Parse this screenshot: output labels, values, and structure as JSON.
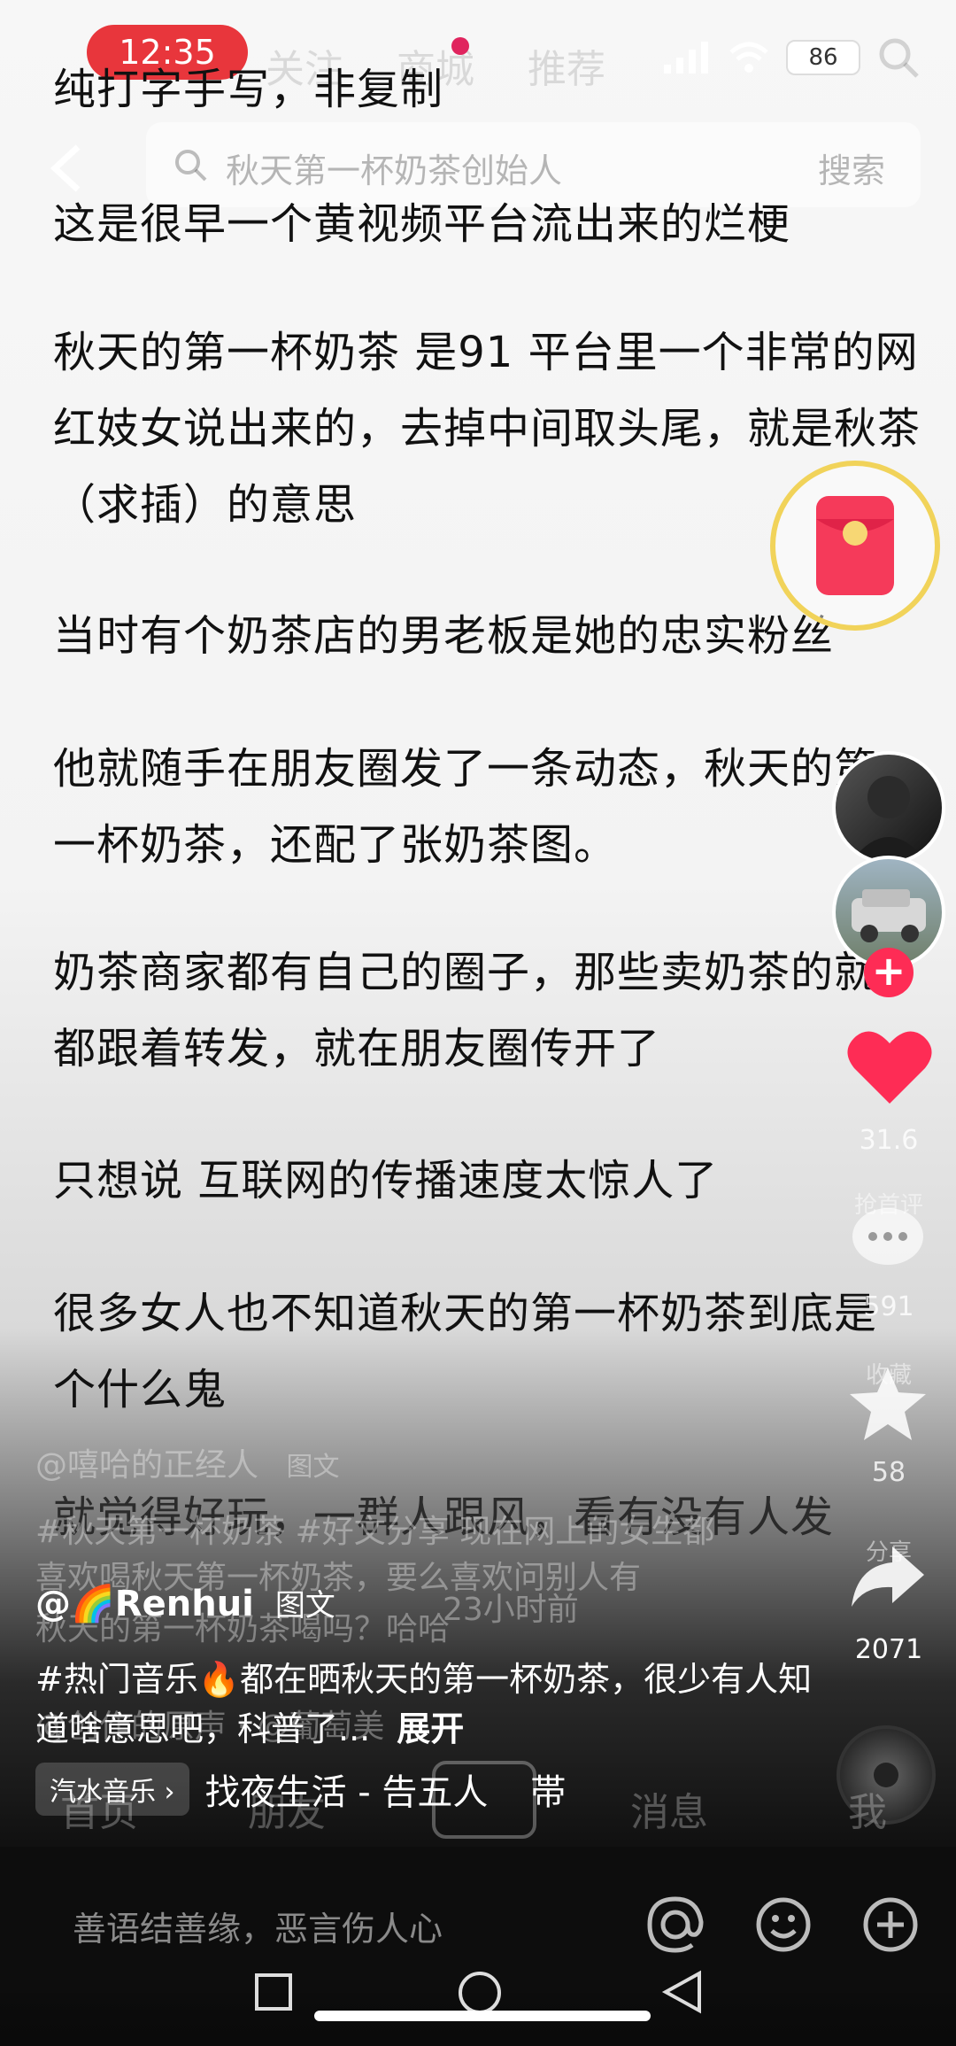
{
  "status_bar": {
    "time": "12:35",
    "battery": "86"
  },
  "top_tabs": [
    "关注",
    "商城",
    "推荐"
  ],
  "search": {
    "placeholder": "秋天第一杯奶茶创始人",
    "button": "搜索"
  },
  "post_body": [
    "纯打字手写，非复制",
    "这是很早一个黄视频平台流出来的烂梗",
    "秋天的第一杯奶茶 是91 平台里一个非常的网红妓女说出来的，去掉中间取头尾，就是秋茶（求插）的意思",
    "当时有个奶茶店的男老板是她的忠实粉丝",
    "他就随手在朋友圈发了一条动态，秋天的第一杯奶茶，还配了张奶茶图。",
    "奶茶商家都有自己的圈子，那些卖奶茶的就都跟着转发，就在朋友圈传开了",
    "只想说 互联网的传播速度太惊人了",
    "很多女人也不知道秋天的第一杯奶茶到底是个什么鬼",
    "就觉得好玩，一群人跟风，看有没有人发"
  ],
  "ghost_overlay": {
    "author": "@嘻哈的正经人",
    "tag": "图文",
    "line1": "#秋天第一杯奶茶 #好文分享 现在网上的女生都",
    "line2": "喜欢喝秋天第一杯奶茶，要么喜欢问别人有",
    "line3": "秋天的第一杯奶茶喝吗？哈哈",
    "time": "23小时前",
    "music": "@创作的原声 · @葡萄美"
  },
  "rail": {
    "likes": "31.6",
    "likes_label": "抢首评",
    "comments": "591",
    "comments_label": "收藏",
    "favorites": "58",
    "favorites_label": "分享",
    "shares": "2071"
  },
  "author": {
    "name": "@🌈Renhui",
    "tag": "图文"
  },
  "caption": {
    "text": "#热门音乐🔥都在晒秋天的第一杯奶茶，很少有人知道啥意思吧，科普了...",
    "expand": "展开"
  },
  "music": {
    "pill": "汽水音乐 ›",
    "track": "找夜生活 - 告五人",
    "extra": "帯"
  },
  "bottom_nav_ghost": [
    "首页",
    "朋友",
    "消息",
    "我"
  ],
  "comment_bar": {
    "placeholder": "善语结善缘，恶言伤人心"
  }
}
